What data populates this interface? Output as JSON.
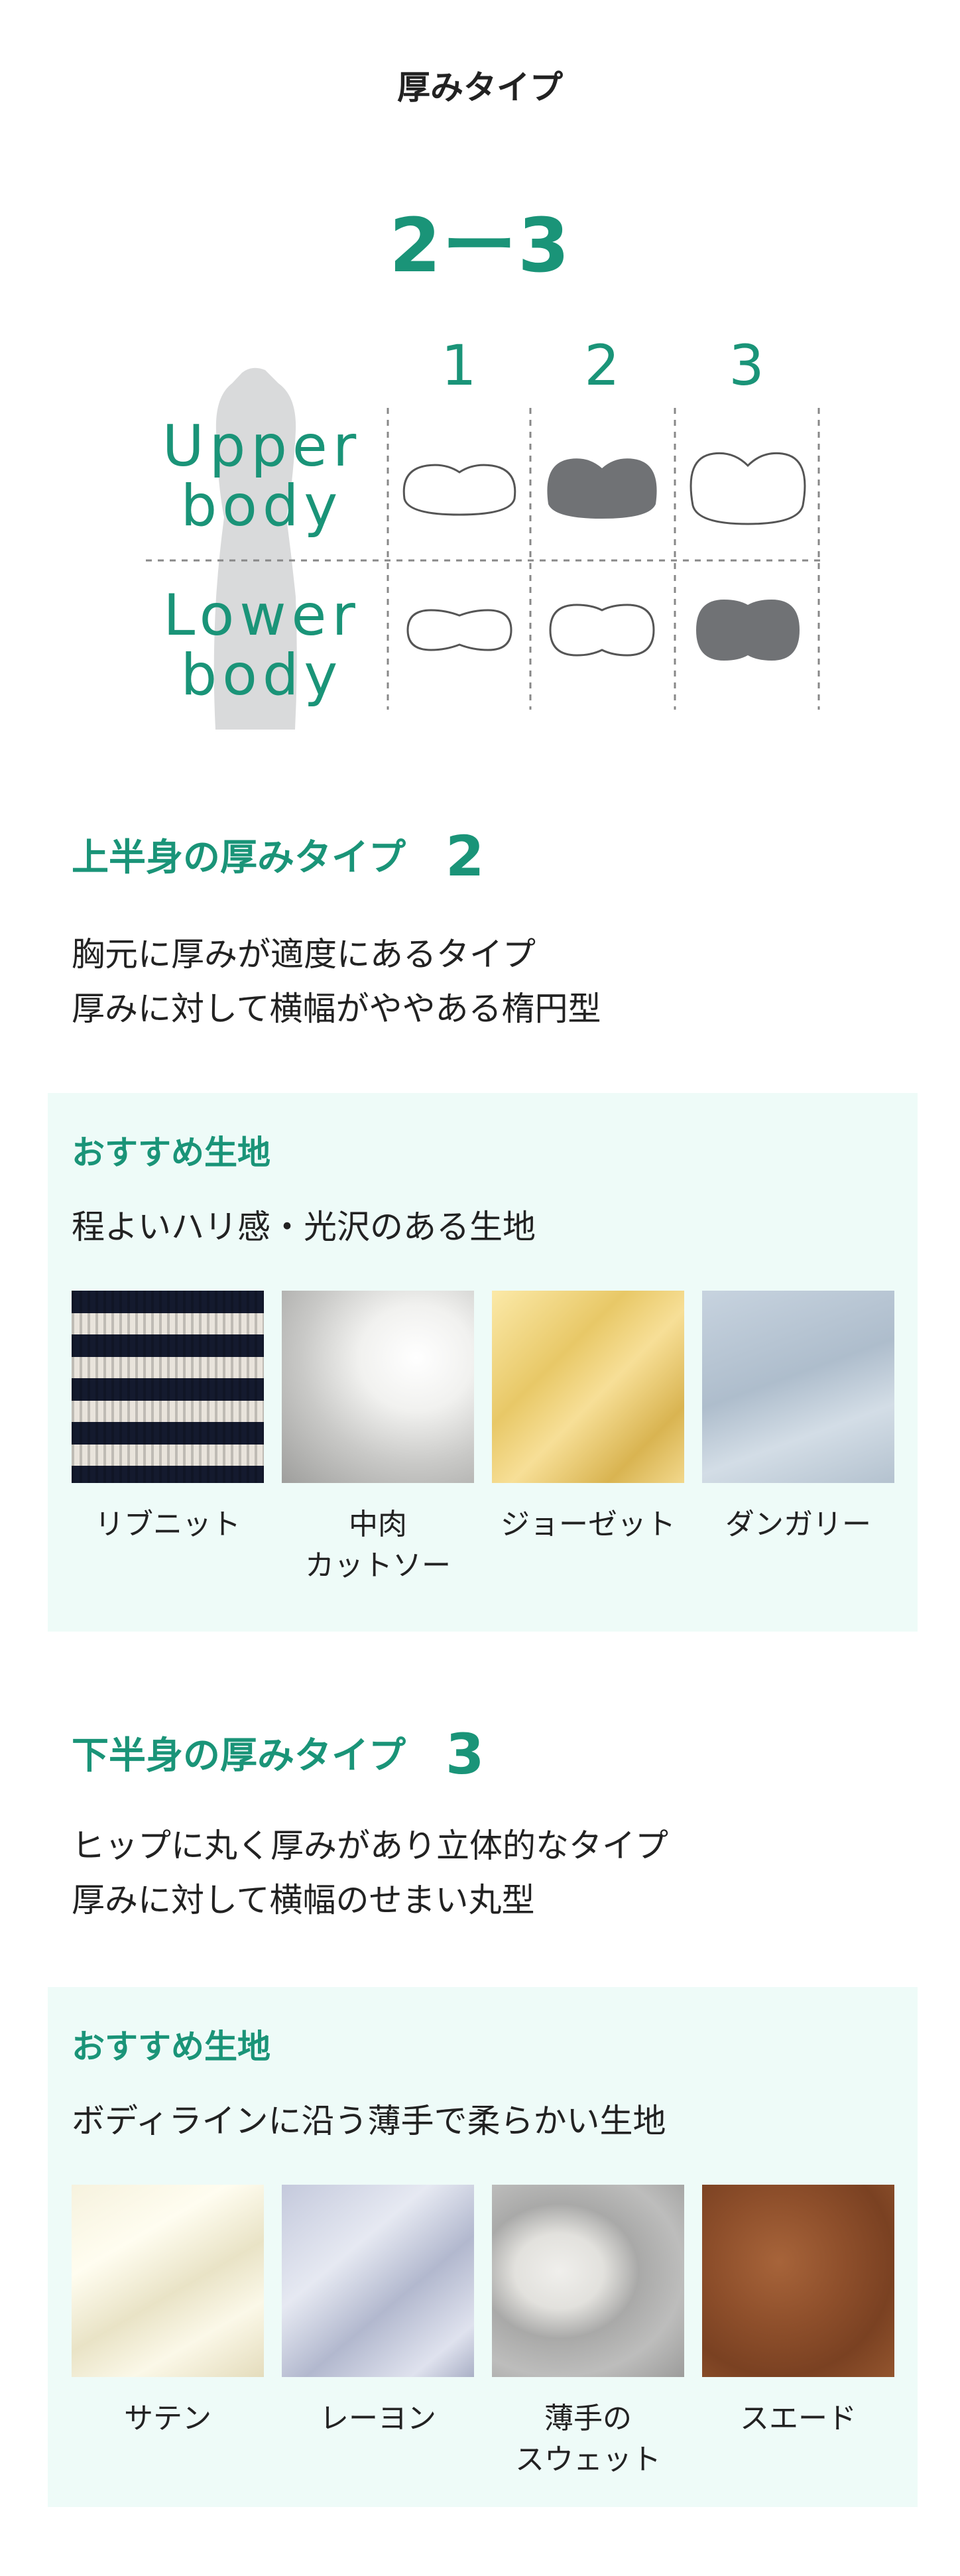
{
  "page_title": "厚みタイプ",
  "type_result": "2ー3",
  "diagram": {
    "columns": [
      "1",
      "2",
      "3"
    ],
    "rows": [
      {
        "label_line1": "Upper",
        "label_line2": "body",
        "selected_index": 1
      },
      {
        "label_line1": "Lower",
        "label_line2": "body",
        "selected_index": 2
      }
    ]
  },
  "upper": {
    "heading": "上半身の厚みタイプ",
    "type_number": "2",
    "desc_line1": "胸元に厚みが適度にあるタイプ",
    "desc_line2": "厚みに対して横幅がややある楕円型",
    "rec_title": "おすすめ生地",
    "rec_sub": "程よいハリ感・光沢のある生地",
    "fabrics": [
      {
        "name_line1": "リブニット",
        "name_line2": ""
      },
      {
        "name_line1": "中肉",
        "name_line2": "カットソー"
      },
      {
        "name_line1": "ジョーゼット",
        "name_line2": ""
      },
      {
        "name_line1": "ダンガリー",
        "name_line2": ""
      }
    ]
  },
  "lower": {
    "heading": "下半身の厚みタイプ",
    "type_number": "3",
    "desc_line1": "ヒップに丸く厚みがあり立体的なタイプ",
    "desc_line2": "厚みに対して横幅のせまい丸型",
    "rec_title": "おすすめ生地",
    "rec_sub": "ボディラインに沿う薄手で柔らかい生地",
    "fabrics": [
      {
        "name_line1": "サテン",
        "name_line2": ""
      },
      {
        "name_line1": "レーヨン",
        "name_line2": ""
      },
      {
        "name_line1": "薄手の",
        "name_line2": "スウェット"
      },
      {
        "name_line1": "スエード",
        "name_line2": ""
      }
    ]
  },
  "colors": {
    "accent": "#1a9478",
    "box_bg": "#eefbf8",
    "selected_shape": "#707275",
    "silhouette": "#d9dadb"
  }
}
